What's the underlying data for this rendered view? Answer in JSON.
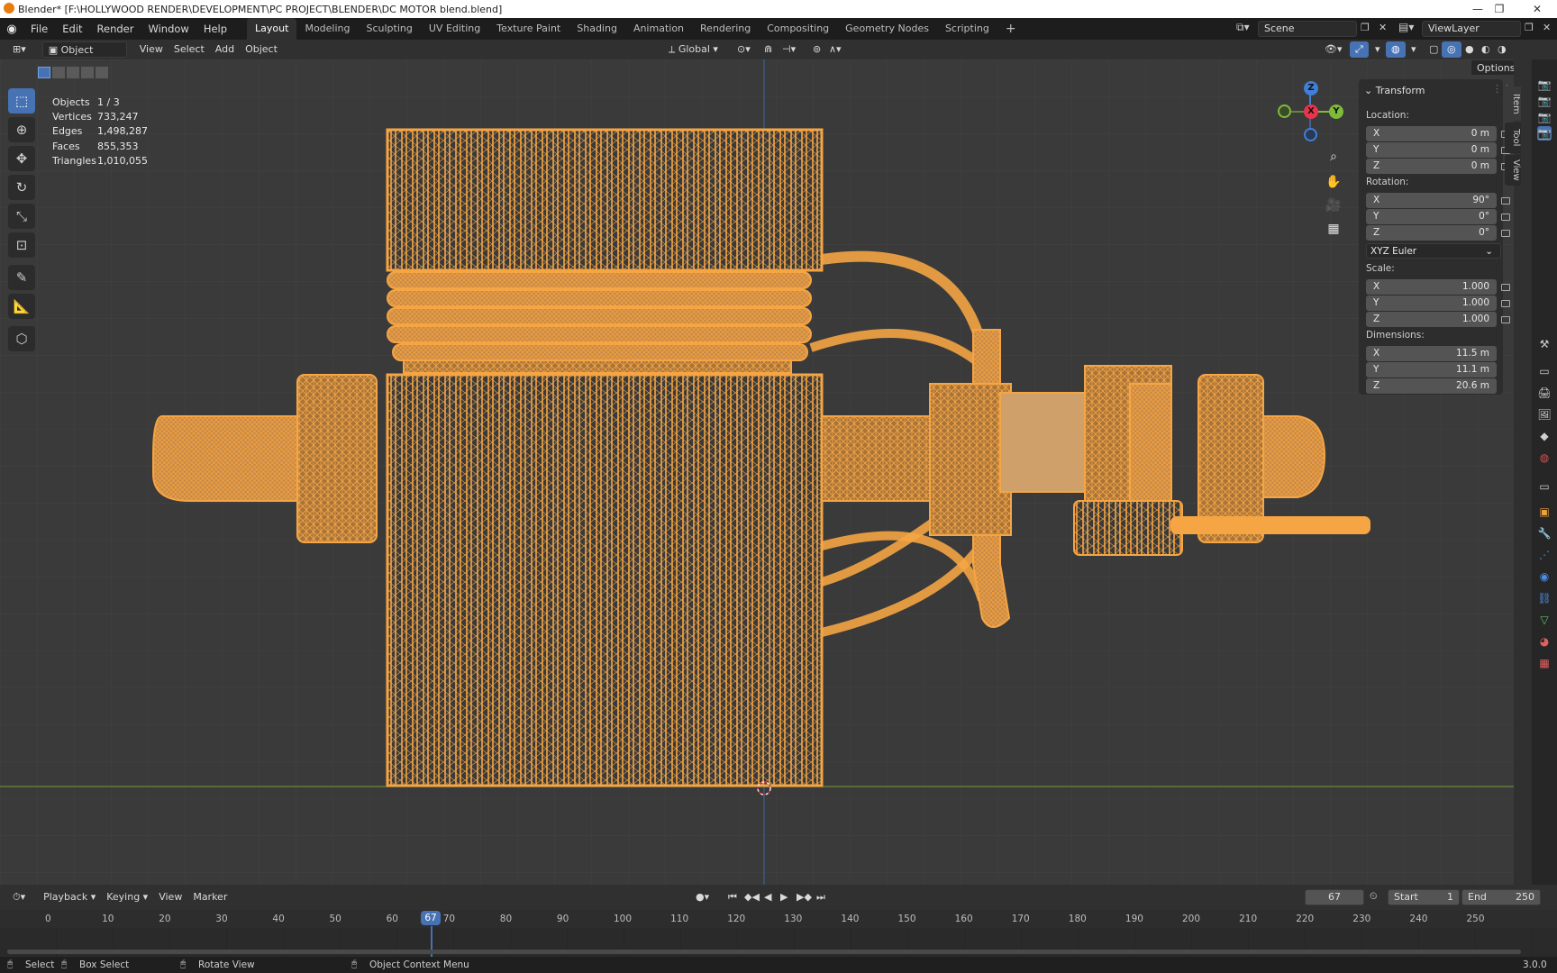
{
  "window": {
    "title": "Blender* [F:\\HOLLYWOOD RENDER\\DEVELOPMENT\\PC PROJECT\\BLENDER\\DC MOTOR blend.blend]"
  },
  "menu": [
    "File",
    "Edit",
    "Render",
    "Window",
    "Help"
  ],
  "workspaces": [
    "Layout",
    "Modeling",
    "Sculpting",
    "UV Editing",
    "Texture Paint",
    "Shading",
    "Animation",
    "Rendering",
    "Compositing",
    "Geometry Nodes",
    "Scripting"
  ],
  "active_workspace": "Layout",
  "scene": {
    "name": "Scene",
    "view_layer": "ViewLayer"
  },
  "header": {
    "mode": "Object Mode",
    "menus": [
      "View",
      "Select",
      "Add",
      "Object"
    ],
    "transform_orientation": "Global",
    "options_label": "Options"
  },
  "stats": [
    {
      "label": "Objects",
      "value": "1 / 3"
    },
    {
      "label": "Vertices",
      "value": "733,247"
    },
    {
      "label": "Edges",
      "value": "1,498,287"
    },
    {
      "label": "Faces",
      "value": "855,353"
    },
    {
      "label": "Triangles",
      "value": "1,010,055"
    }
  ],
  "gizmo": {
    "x": "X",
    "y": "Y",
    "z": "Z"
  },
  "npanel": {
    "title": "Transform",
    "location_label": "Location:",
    "location": [
      {
        "axis": "X",
        "value": "0 m"
      },
      {
        "axis": "Y",
        "value": "0 m"
      },
      {
        "axis": "Z",
        "value": "0 m"
      }
    ],
    "rotation_label": "Rotation:",
    "rotation": [
      {
        "axis": "X",
        "value": "90°"
      },
      {
        "axis": "Y",
        "value": "0°"
      },
      {
        "axis": "Z",
        "value": "0°"
      }
    ],
    "rotation_mode": "XYZ Euler",
    "scale_label": "Scale:",
    "scale": [
      {
        "axis": "X",
        "value": "1.000"
      },
      {
        "axis": "Y",
        "value": "1.000"
      },
      {
        "axis": "Z",
        "value": "1.000"
      }
    ],
    "dimensions_label": "Dimensions:",
    "dimensions": [
      {
        "axis": "X",
        "value": "11.5 m"
      },
      {
        "axis": "Y",
        "value": "11.1 m"
      },
      {
        "axis": "Z",
        "value": "20.6 m"
      }
    ],
    "tabs": [
      "Item",
      "Tool",
      "View"
    ]
  },
  "timeline": {
    "menus": [
      "Playback",
      "Keying",
      "View",
      "Marker"
    ],
    "current_frame": "67",
    "start_label": "Start",
    "start": "1",
    "end_label": "End",
    "end": "250",
    "ticks": [
      "0",
      "10",
      "20",
      "30",
      "40",
      "50",
      "60",
      "70",
      "80",
      "90",
      "100",
      "110",
      "120",
      "130",
      "140",
      "150",
      "160",
      "170",
      "180",
      "190",
      "200",
      "210",
      "220",
      "230",
      "240",
      "250"
    ]
  },
  "status": {
    "items": [
      "Select",
      "Box Select",
      "Rotate View",
      "Object Context Menu"
    ],
    "version": "3.0.0"
  },
  "colors": {
    "mesh": "#f5a544",
    "accent": "#4772b3",
    "x_axis": "#e8354c",
    "y_axis": "#7fbb3a",
    "z_axis": "#3f7fd9"
  }
}
